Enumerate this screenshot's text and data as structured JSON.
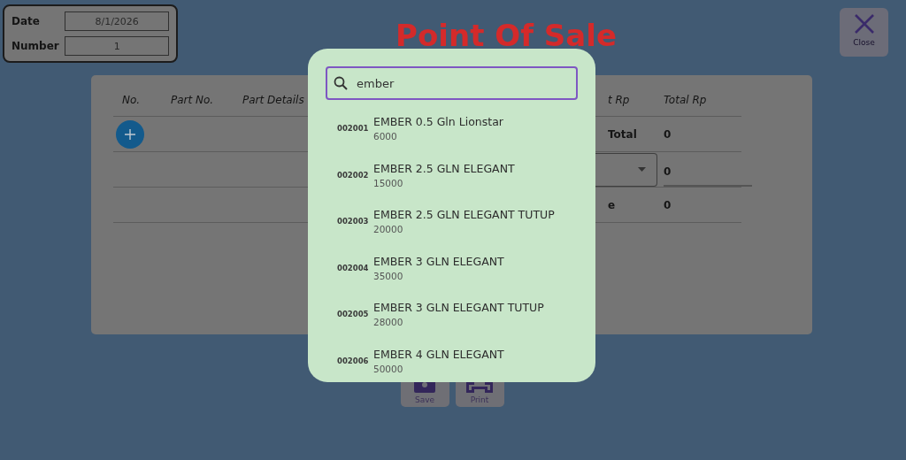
{
  "header": {
    "fields": [
      {
        "label": "Date",
        "value": "8/1/2026"
      },
      {
        "label": "Number",
        "value": "1"
      }
    ]
  },
  "title": "Point Of Sale",
  "close_button": {
    "label": "Close"
  },
  "table": {
    "columns": [
      "No.",
      "Part No.",
      "Part Details",
      "t Rp",
      "Total Rp"
    ],
    "summary": [
      {
        "kind": "text",
        "label": "Total",
        "value": "0"
      },
      {
        "kind": "dropdown",
        "value": "0"
      },
      {
        "kind": "text",
        "label": "e",
        "value": "0"
      }
    ]
  },
  "actions": [
    {
      "kind": "save",
      "label": "Save"
    },
    {
      "kind": "print",
      "label": "Print"
    }
  ],
  "search_popup": {
    "query": "ember",
    "results": [
      {
        "code": "002001",
        "name": "EMBER 0.5 Gln Lionstar",
        "price": "6000"
      },
      {
        "code": "002002",
        "name": "EMBER 2.5 GLN ELEGANT",
        "price": "15000"
      },
      {
        "code": "002003",
        "name": "EMBER 2.5 GLN ELEGANT TUTUP",
        "price": "20000"
      },
      {
        "code": "002004",
        "name": "EMBER 3 GLN ELEGANT",
        "price": "35000"
      },
      {
        "code": "002005",
        "name": "EMBER 3 GLN ELEGANT TUTUP",
        "price": "28000"
      },
      {
        "code": "002006",
        "name": "EMBER 4 GLN ELEGANT",
        "price": "50000"
      }
    ]
  }
}
